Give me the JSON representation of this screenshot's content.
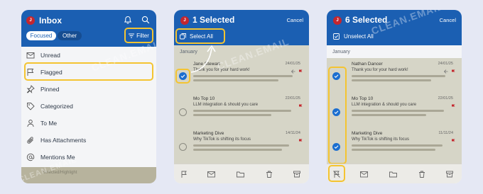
{
  "colors": {
    "brand": "#1b5fb2",
    "highlight": "#f4c431",
    "check": "#1b6ed0",
    "flag": "#c4262e"
  },
  "avatar_initial": "J",
  "watermark": "CLEAN.EMAIL",
  "panel1": {
    "title": "Inbox",
    "tabs": [
      "Focused",
      "Other"
    ],
    "filter_label": "Filter",
    "menu": [
      {
        "label": "Unread",
        "icon": "envelope-icon"
      },
      {
        "label": "Flagged",
        "icon": "flag-icon"
      },
      {
        "label": "Pinned",
        "icon": "pin-icon"
      },
      {
        "label": "Categorized",
        "icon": "tag-icon"
      },
      {
        "label": "To Me",
        "icon": "person-icon"
      },
      {
        "label": "Has Attachments",
        "icon": "paperclip-icon"
      },
      {
        "label": "Mentions Me",
        "icon": "at-icon"
      }
    ],
    "footer_fade_text": "Selected/Highlight"
  },
  "panel2": {
    "title": "1 Selected",
    "cancel": "Cancel",
    "action": "Select All",
    "month": "January",
    "emails": [
      {
        "sender": "Jane Stewart",
        "date": "24/01/25",
        "subject": "Thank you for your hard work!",
        "checked": true
      },
      {
        "sender": "Mo Top 10",
        "date": "22/01/25",
        "subject": "LLM integration & should you care",
        "checked": false
      },
      {
        "sender": "Marketing Dive",
        "date": "14/11/24",
        "subject": "Why TikTok is shifting its focus",
        "checked": false
      }
    ]
  },
  "panel3": {
    "title": "6 Selected",
    "cancel": "Cancel",
    "action": "Unselect All",
    "month": "January",
    "emails": [
      {
        "sender": "Nathan Dancer",
        "date": "24/01/25",
        "subject": "Thank you for your hard work!",
        "checked": true
      },
      {
        "sender": "Mo Top 10",
        "date": "22/01/25",
        "subject": "LLM integration & should you care",
        "checked": true
      },
      {
        "sender": "Marketing Dive",
        "date": "11/11/24",
        "subject": "Why TikTok is shifting its focus",
        "checked": true
      }
    ]
  }
}
